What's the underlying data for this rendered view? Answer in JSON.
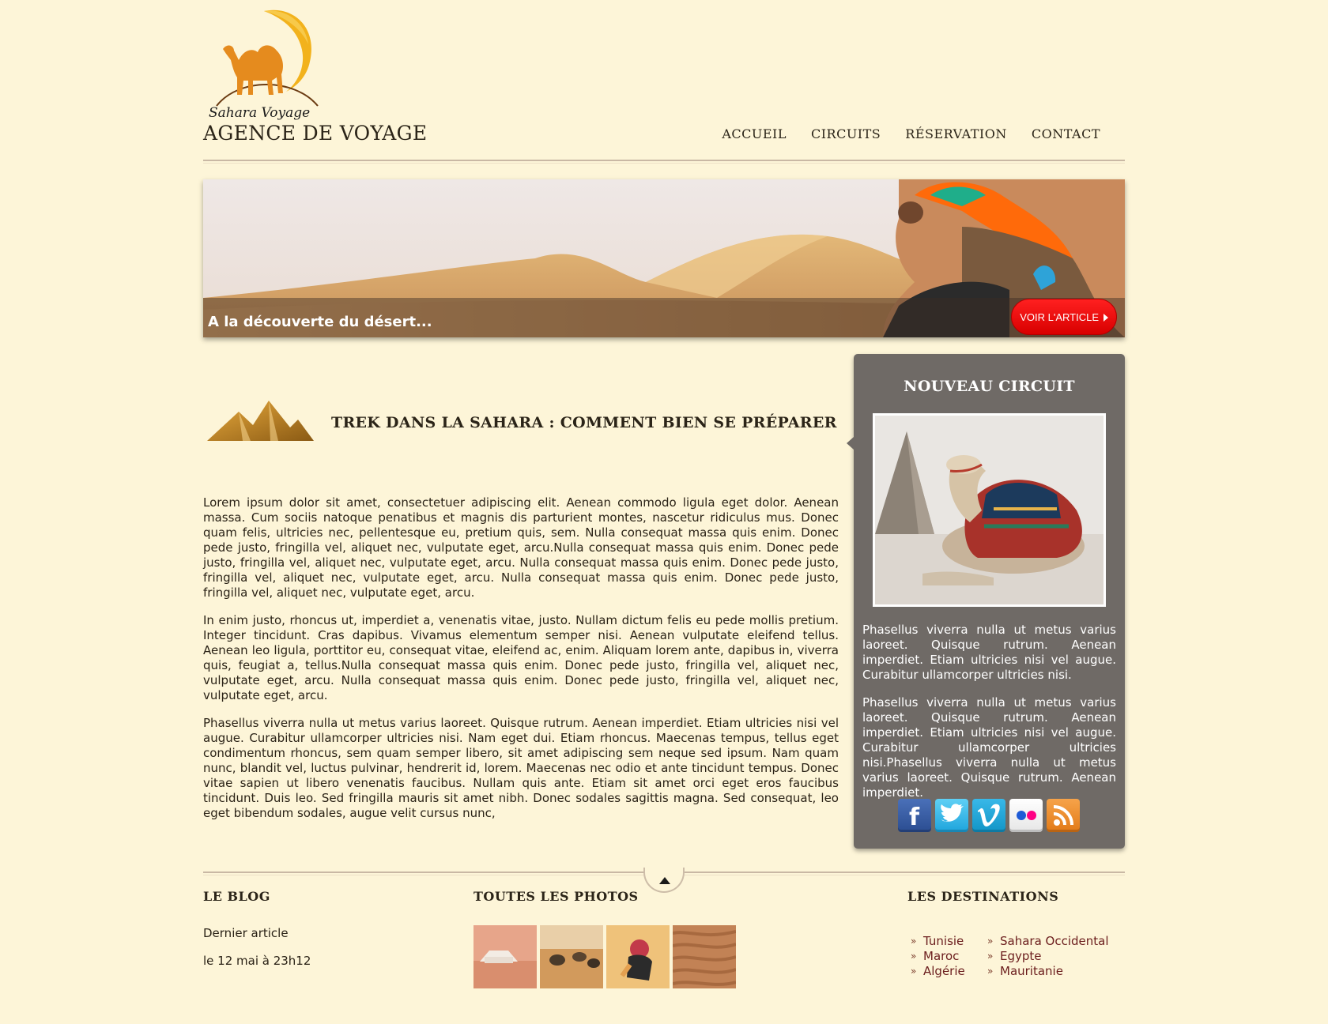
{
  "header": {
    "logo_text": "Sahara Voyage",
    "tagline": "AGENCE DE VOYAGE",
    "nav": [
      "ACCUEIL",
      "CIRCUITS",
      "RÉSERVATION",
      "CONTACT"
    ]
  },
  "banner": {
    "caption": "A la découverte du désert...",
    "button_label": "VOIR L'ARTICLE"
  },
  "article": {
    "title": "TREK DANS LA SAHARA : COMMENT BIEN SE PRÉPARER",
    "paragraphs": [
      "Lorem ipsum dolor sit amet, consectetuer adipiscing elit. Aenean commodo ligula eget dolor. Aenean massa. Cum sociis natoque penatibus et magnis dis parturient montes, nascetur ridiculus mus. Donec quam felis, ultricies nec, pellentesque eu, pretium quis, sem. Nulla consequat massa quis enim. Donec pede justo, fringilla vel, aliquet nec, vulputate eget, arcu.Nulla consequat massa quis enim. Donec pede justo, fringilla vel, aliquet nec, vulputate eget, arcu. Nulla consequat massa quis enim. Donec pede justo, fringilla vel, aliquet nec, vulputate eget, arcu. Nulla consequat massa quis enim. Donec pede justo, fringilla vel, aliquet nec, vulputate eget, arcu.",
      "In enim justo, rhoncus ut, imperdiet a, venenatis vitae, justo. Nullam dictum felis eu pede mollis pretium. Integer tincidunt. Cras dapibus. Vivamus elementum semper nisi. Aenean vulputate eleifend tellus. Aenean leo ligula, porttitor eu, consequat vitae, eleifend ac, enim. Aliquam lorem ante, dapibus in, viverra quis, feugiat a, tellus.Nulla consequat massa quis enim. Donec pede justo, fringilla vel, aliquet nec, vulputate eget, arcu. Nulla consequat massa quis enim. Donec pede justo, fringilla vel, aliquet nec, vulputate eget, arcu.",
      "Phasellus viverra nulla ut metus varius laoreet. Quisque rutrum. Aenean imperdiet. Etiam ultricies nisi vel augue. Curabitur ullamcorper ultricies nisi. Nam eget dui. Etiam rhoncus. Maecenas tempus, tellus eget condimentum rhoncus, sem quam semper libero, sit amet adipiscing sem neque sed ipsum. Nam quam nunc, blandit vel, luctus pulvinar, hendrerit id, lorem. Maecenas nec odio et ante tincidunt tempus. Donec vitae sapien ut libero venenatis faucibus. Nullam quis ante. Etiam sit amet orci eget eros faucibus tincidunt. Duis leo. Sed fringilla mauris sit amet nibh. Donec sodales sagittis magna. Sed consequat, leo eget bibendum sodales, augue velit cursus nunc,"
    ]
  },
  "sidebar": {
    "title": "NOUVEAU CIRCUIT",
    "paragraphs": [
      "Phasellus viverra nulla ut metus varius laoreet. Quisque rutrum. Aenean imperdiet. Etiam ultricies nisi vel augue. Curabitur ullamcorper ultricies nisi.",
      "Phasellus viverra nulla ut metus varius laoreet. Quisque rutrum. Aenean imperdiet. Etiam ultricies nisi vel augue. Curabitur ullamcorper ultricies nisi.Phasellus viverra nulla ut metus varius laoreet. Quisque rutrum. Aenean imperdiet."
    ],
    "social_icons": [
      "facebook-icon",
      "twitter-icon",
      "vimeo-icon",
      "flickr-icon",
      "rss-icon"
    ]
  },
  "footer": {
    "blog": {
      "title": "LE BLOG",
      "latest_label": "Dernier article",
      "date": "le 12 mai à 23h12"
    },
    "photos": {
      "title": "TOUTES LES PHOTOS"
    },
    "destinations": {
      "title": "LES DESTINATIONS",
      "col1": [
        "Tunisie",
        "Maroc",
        "Algérie"
      ],
      "col2": [
        "Sahara Occidental",
        "Egypte",
        "Mauritanie"
      ]
    }
  },
  "colors": {
    "background": "#fdf5d8",
    "sidebar": "#6f6a66",
    "button_red": "#e50000",
    "link": "#6b1d1d",
    "gold": "#e8a317"
  }
}
